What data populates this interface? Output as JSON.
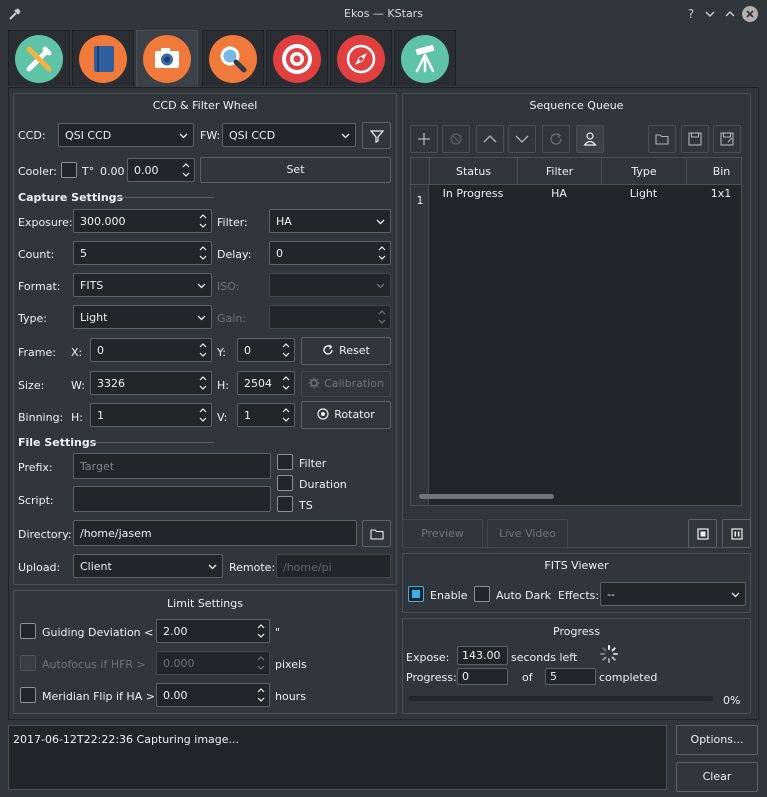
{
  "window": {
    "title": "Ekos — KStars",
    "help": "?",
    "minimize": "⌄",
    "maximize": "⌃",
    "close": "×"
  },
  "tabs": [
    {
      "name": "setup",
      "icon": "tools-icon",
      "color": "#5fc3a6"
    },
    {
      "name": "scheduler",
      "icon": "notebook-icon",
      "color": "#3a6aa8"
    },
    {
      "name": "ccd",
      "icon": "camera-icon",
      "color": "#f07a3c"
    },
    {
      "name": "focus",
      "icon": "magnifier-icon",
      "color": "#f07a3c"
    },
    {
      "name": "align",
      "icon": "target-icon",
      "color": "#e04040"
    },
    {
      "name": "guide",
      "icon": "compass-icon",
      "color": "#e04040"
    },
    {
      "name": "mount",
      "icon": "tripod-icon",
      "color": "#5fc3a6"
    }
  ],
  "ccd": {
    "group_title": "CCD & Filter Wheel",
    "ccd_label": "CCD:",
    "ccd_value": "QSI CCD",
    "fw_label": "FW:",
    "fw_value": "QSI CCD",
    "cooler_label": "Cooler:",
    "temp_label": "T°",
    "temp_value": "0.00",
    "temp_set": "0.00",
    "set_button": "Set"
  },
  "capture": {
    "title": "Capture Settings",
    "exposure_label": "Exposure:",
    "exposure_value": "300.000",
    "filter_label": "Filter:",
    "filter_value": "HA",
    "count_label": "Count:",
    "count_value": "5",
    "delay_label": "Delay:",
    "delay_value": "0",
    "format_label": "Format:",
    "format_value": "FITS",
    "iso_label": "ISO:",
    "iso_value": "",
    "type_label": "Type:",
    "type_value": "Light",
    "gain_label": "Gain:",
    "gain_value": "",
    "frame_label": "Frame:",
    "x_label": "X:",
    "x_value": "0",
    "y_label": "Y:",
    "y_value": "0",
    "reset_button": "Reset",
    "size_label": "Size:",
    "w_label": "W:",
    "w_value": "3326",
    "h_label": "H:",
    "h_value": "2504",
    "calibration_button": "Calibration",
    "binning_label": "Binning:",
    "binh_label": "H:",
    "binh_value": "1",
    "binv_label": "V:",
    "binv_value": "1",
    "rotator_button": "Rotator"
  },
  "file": {
    "title": "File Settings",
    "prefix_label": "Prefix:",
    "prefix_placeholder": "Target",
    "filter_check": "Filter",
    "duration_check": "Duration",
    "ts_check": "TS",
    "script_label": "Script:",
    "script_value": "",
    "directory_label": "Directory:",
    "directory_value": "/home/jasem",
    "upload_label": "Upload:",
    "upload_value": "Client",
    "remote_label": "Remote:",
    "remote_placeholder": "/home/pi"
  },
  "limits": {
    "title": "Limit Settings",
    "guiding_label": "Guiding Deviation <",
    "guiding_value": "2.00",
    "guiding_unit": "\"",
    "autofocus_label": "Autofocus if HFR >",
    "autofocus_value": "0.000",
    "autofocus_unit": "pixels",
    "meridian_label": "Meridian Flip if HA >",
    "meridian_value": "0.00",
    "meridian_unit": "hours"
  },
  "queue": {
    "title": "Sequence Queue",
    "columns": [
      "Status",
      "Filter",
      "Type",
      "Bin"
    ],
    "rows": [
      {
        "num": "1",
        "status": "In Progress",
        "filter": "HA",
        "type": "Light",
        "bin": "1x1"
      }
    ],
    "preview_button": "Preview",
    "live_button": "Live Video"
  },
  "fits": {
    "title": "FITS Viewer",
    "enable_label": "Enable",
    "autodark_label": "Auto Dark",
    "effects_label": "Effects:",
    "effects_value": "--"
  },
  "progress": {
    "title": "Progress",
    "expose_label": "Expose:",
    "expose_value": "143.00",
    "seconds_left": "seconds left",
    "progress_label": "Progress:",
    "progress_value": "0",
    "of_label": "of",
    "total_value": "5",
    "completed_label": "completed",
    "percent": "0%",
    "fraction": 0
  },
  "log": {
    "text": "2017-06-12T22:22:36 Capturing image...",
    "options_button": "Options...",
    "clear_button": "Clear"
  },
  "colors": {
    "accent": "#3daee9",
    "bg": "#31363b",
    "field": "#232629"
  }
}
